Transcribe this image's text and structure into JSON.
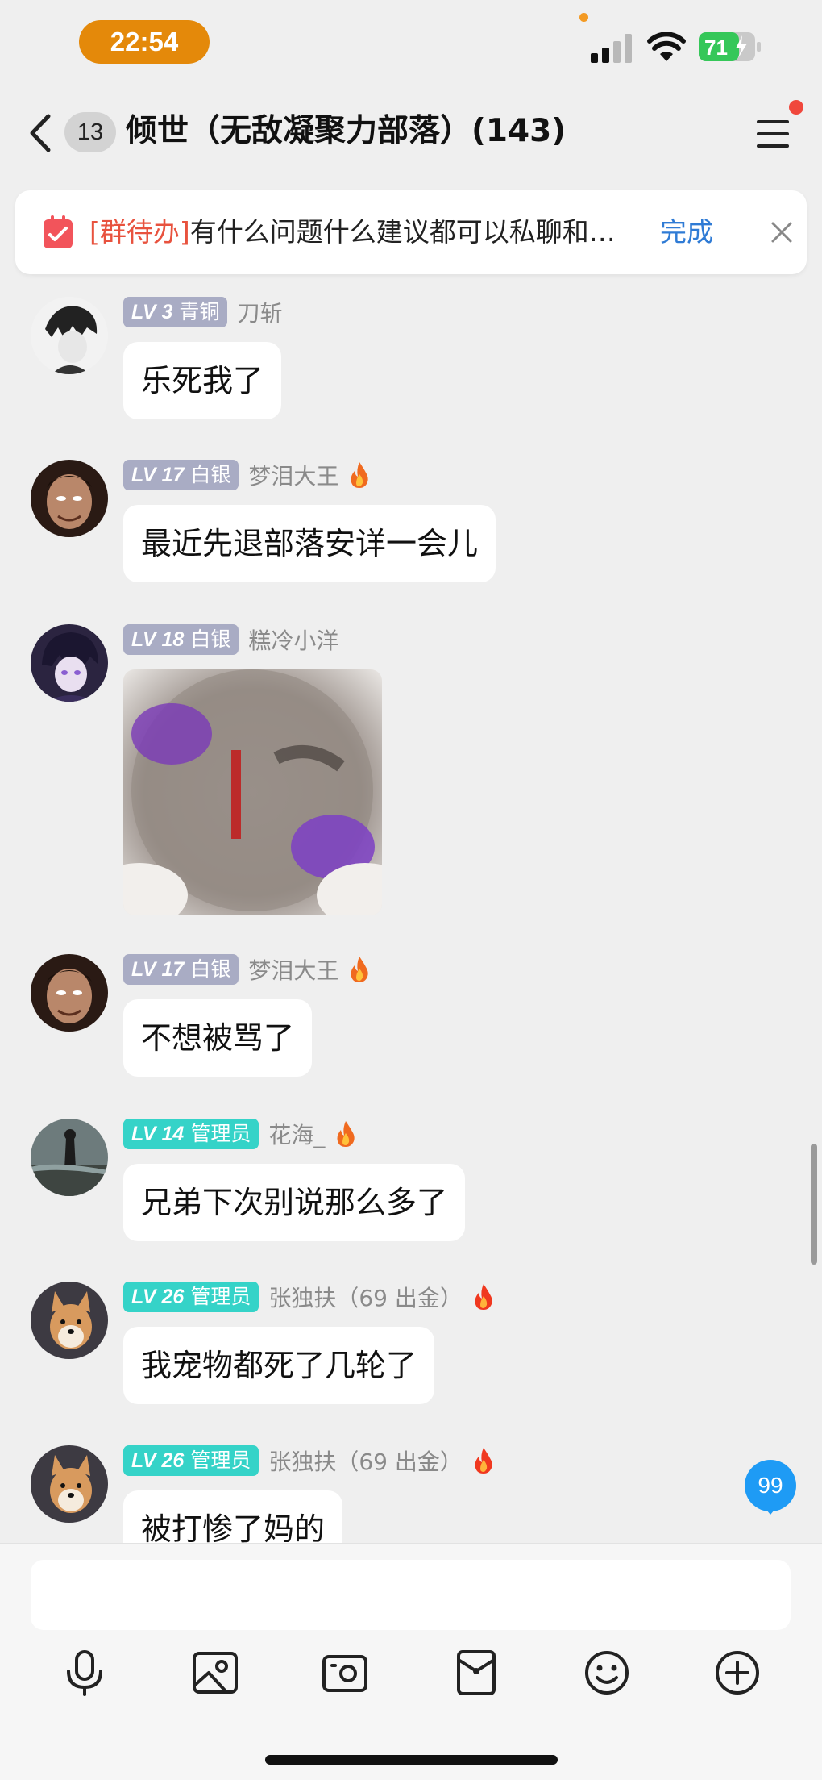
{
  "status_bar": {
    "time": "22:54",
    "battery": "71",
    "icons": [
      "cellular-signal-icon",
      "wifi-icon",
      "battery-charging-icon"
    ]
  },
  "header": {
    "unread_count": "13",
    "title": "倾世（无敌凝聚力部落）(143)",
    "icons": [
      "chevron-left-icon",
      "menu-icon"
    ]
  },
  "todo": {
    "tag": "[群待办]",
    "text": "有什么问题什么建议都可以私聊和…",
    "done_label": "完成",
    "icons": [
      "clipboard-icon",
      "close-icon"
    ]
  },
  "messages": [
    {
      "level": "LV 3",
      "rank": "青铜",
      "nickname": "刀斩",
      "badge_color": "gray",
      "fire": false,
      "text": "乐死我了"
    },
    {
      "level": "LV 17",
      "rank": "白银",
      "nickname": "梦泪大王",
      "badge_color": "gray",
      "fire": true,
      "text": "最近先退部落安详一会儿"
    },
    {
      "level": "LV 18",
      "rank": "白银",
      "nickname": "糕冷小洋",
      "badge_color": "gray",
      "fire": false,
      "sticker": true
    },
    {
      "level": "LV 17",
      "rank": "白银",
      "nickname": "梦泪大王",
      "badge_color": "gray",
      "fire": true,
      "text": "不想被骂了"
    },
    {
      "level": "LV 14",
      "rank": "管理员",
      "nickname": "花海_",
      "badge_color": "teal",
      "fire": true,
      "text": "兄弟下次别说那么多了"
    },
    {
      "level": "LV 26",
      "rank": "管理员",
      "nickname": "张独扶（69 出金）",
      "badge_color": "teal",
      "fire": true,
      "text": "我宠物都死了几轮了"
    },
    {
      "level": "LV 26",
      "rank": "管理员",
      "nickname": "张独扶（69 出金）",
      "badge_color": "teal",
      "fire": true,
      "text": "被打惨了妈的"
    }
  ],
  "new_message_badge": "99",
  "toolbar": [
    "microphone-icon",
    "image-icon",
    "camera-icon",
    "red-packet-icon",
    "emoji-icon",
    "plus-circle-icon"
  ],
  "colors": {
    "accent_blue": "#2f7bd5",
    "time_pill": "#e4890a",
    "badge_gray": "#a9acc4",
    "badge_teal": "#35d3c8",
    "todo_tag": "#e8523e",
    "notify_badge": "#1e9bf5"
  }
}
